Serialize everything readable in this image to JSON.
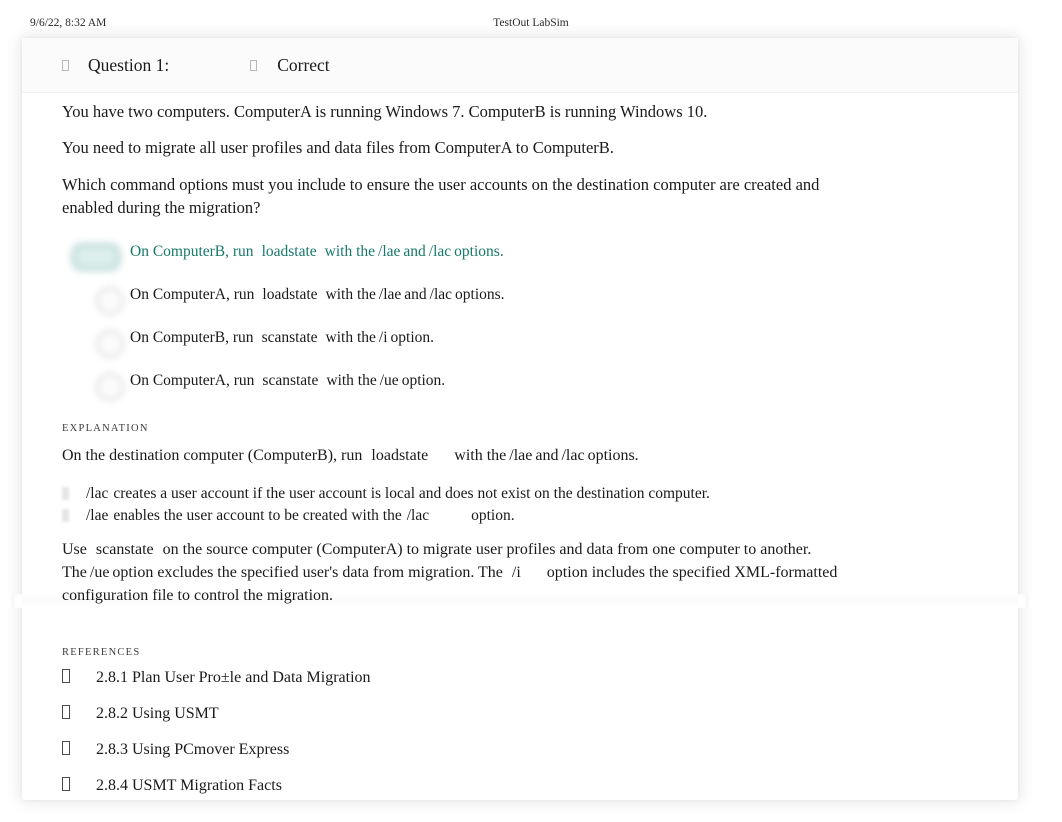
{
  "print_header": {
    "timestamp": "9/6/22, 8:32 AM",
    "title": "TestOut LabSim"
  },
  "question_header": {
    "label": "Question 1:",
    "result": "Correct",
    "bullet_glyph": "tofu-box-icon",
    "result_glyph": "tofu-box-icon"
  },
  "stem": {
    "paragraphs": [
      "You have two computers. ComputerA is running Windows 7. ComputerB is running Windows 10.",
      "You need to migrate all user profiles and data files from ComputerA to ComputerB.",
      "Which command options must you include to ensure the user accounts on the destination computer are created and enabled during the migration?"
    ]
  },
  "options": [
    {
      "correct": true,
      "lead": "On ComputerB, run",
      "code1": "loadstate",
      "mid": "with the",
      "code2": "/lae",
      "conj": "and",
      "code3": "/lac",
      "tail": "options."
    },
    {
      "correct": false,
      "lead": "On ComputerA, run",
      "code1": "loadstate",
      "mid": "with the",
      "code2": "/lae",
      "conj": "and",
      "code3": "/lac",
      "tail": "options."
    },
    {
      "correct": false,
      "lead": "On ComputerB, run",
      "code1": "scanstate",
      "mid": "with the",
      "code2": "/i",
      "conj": "",
      "code3": "",
      "tail": "option."
    },
    {
      "correct": false,
      "lead": "On ComputerA, run",
      "code1": "scanstate",
      "mid": "with the",
      "code2": "/ue",
      "conj": "",
      "code3": "",
      "tail": "option."
    }
  ],
  "explanation": {
    "section_label": "EXPLANATION",
    "intro": {
      "lead": "On the destination computer (ComputerB), run",
      "code1": "loadstate",
      "mid": "with the",
      "code2": "/lae",
      "conj": "and",
      "code3": "/lac",
      "tail": "options."
    },
    "bullets": [
      {
        "code": "/lac",
        "text": "creates a user account if the user account is local and does not exist on the destination computer.",
        "code2": "",
        "text2": ""
      },
      {
        "code": "/lae",
        "text": "enables the user account to be created with the",
        "code2": "/lac",
        "text2": "option."
      }
    ],
    "tail": {
      "lead": "Use",
      "code1": "scanstate",
      "mid1": "on the source computer (ComputerA) to migrate user profiles and data from one computer to another. The",
      "code2": "/ue",
      "mid2": "option excludes the specified user's data from migration. The",
      "code3": "/i",
      "mid3": "option includes the specified XML-formatted configuration file to control the migration."
    }
  },
  "references": {
    "section_label": "REFERENCES",
    "items": [
      {
        "glyph": "tofu-box-icon",
        "text": "2.8.1 Plan User Pro±le and Data Migration"
      },
      {
        "glyph": "tofu-box-icon",
        "text": "2.8.2 Using USMT"
      },
      {
        "glyph": "tofu-box-icon",
        "text": "2.8.3 Using PCmover Express"
      },
      {
        "glyph": "tofu-box-icon",
        "text": "2.8.4 USMT Migration Facts"
      }
    ]
  },
  "colors": {
    "correct_answer": "#17786c",
    "page_background": "#ffffff",
    "card_background": "#ffffff",
    "header_band": "#fbfbfb",
    "body_text": "#1a1a1a"
  }
}
